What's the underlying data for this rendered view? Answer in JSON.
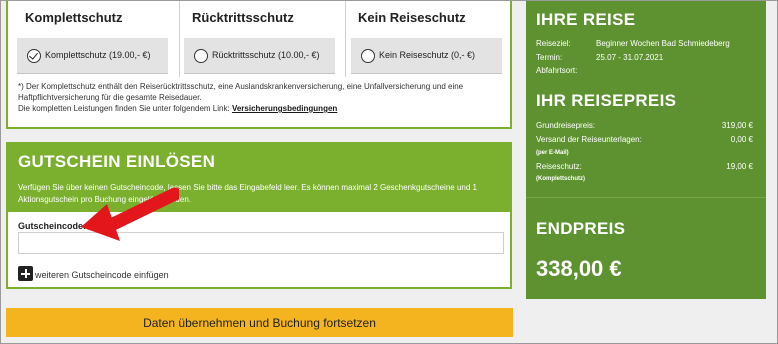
{
  "insurance": {
    "options": [
      {
        "title": "Komplettschutz",
        "label": "Komplettschutz (19.00,- €)",
        "selected": true
      },
      {
        "title": "Rücktrittsschutz",
        "label": "Rücktrittsschutz (10.00,- €)",
        "selected": false
      },
      {
        "title": "Kein Reiseschutz",
        "label": "Kein Reiseschutz (0,- €)",
        "selected": false
      }
    ],
    "note": "*) Der Komplettschutz enthält den Reiserücktrittsschutz, eine Auslandskrankenversicherung, eine Unfallversicherung und eine Haftpflichtversicherung für die gesamte Reisedauer.",
    "link_prefix": "Die kompletten Leistungen finden Sie unter folgendem Link:",
    "link_text": "Versicherungsbedingungen"
  },
  "voucher": {
    "title": "GUTSCHEIN EINLÖSEN",
    "text": "Verfügen Sie über keinen Gutscheincode, lassen Sie bitte das Eingabefeld leer. Es können maximal 2 Geschenkgutscheine und 1 Aktionsgutschein pro Buchung eingelöst werden.",
    "label": "Gutscheincode:",
    "value": "",
    "add_label": "weiteren Gutscheincode einfügen"
  },
  "submit_label": "Daten übernehmen und Buchung fortsetzen",
  "sidebar": {
    "trip_title": "IHRE REISE",
    "destination_label": "Reiseziel:",
    "destination_value": "Beginner Wochen Bad Schmiedeberg",
    "date_label": "Termin:",
    "date_value": "25.07 - 31.07.2021",
    "departure_label": "Abfahrtsort:",
    "price_title": "IHR REISEPREIS",
    "base_label": "Grundreisepreis:",
    "base_value": "319,00 €",
    "shipping_label": "Versand der Reiseunterlagen:",
    "shipping_value": "0,00 €",
    "shipping_note": "(per E-Mail)",
    "insurance_label": "Reiseschutz:",
    "insurance_value": "19,00 €",
    "insurance_note": "(Komplettschutz)",
    "final_title": "ENDPREIS",
    "final_value": "338,00 €"
  },
  "colors": {
    "green": "#7bb02e",
    "dark_green": "#5e9230",
    "button": "#f4b41f",
    "arrow": "#e2161b"
  }
}
